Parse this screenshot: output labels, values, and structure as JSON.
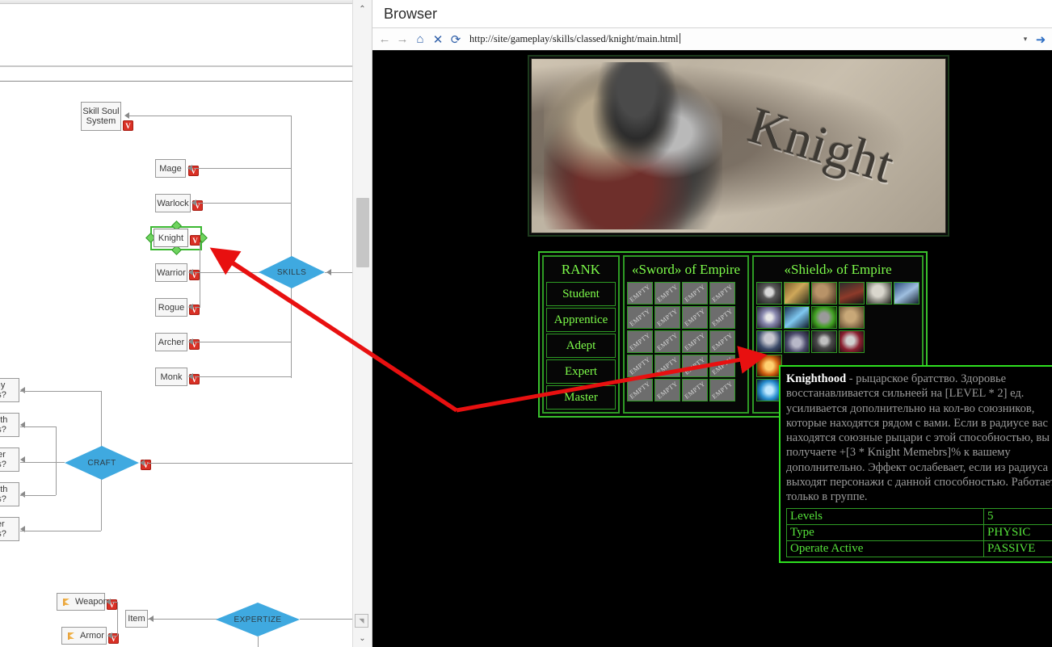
{
  "diagram": {
    "nodes": [
      {
        "id": "skill-soul-system",
        "label": "Skill Soul\nSystem"
      },
      {
        "id": "mage",
        "label": "Mage"
      },
      {
        "id": "warlock",
        "label": "Warlock"
      },
      {
        "id": "knight",
        "label": "Knight"
      },
      {
        "id": "warrior",
        "label": "Warrior"
      },
      {
        "id": "rogue",
        "label": "Rogue"
      },
      {
        "id": "archer",
        "label": "Archer"
      },
      {
        "id": "monk",
        "label": "Monk"
      },
      {
        "id": "item",
        "label": "Item"
      },
      {
        "id": "weapon",
        "label": "Weapon"
      },
      {
        "id": "armor",
        "label": "Armor"
      }
    ],
    "clipped_nodes": [
      {
        "id": "alchemy-recipes",
        "label": "my\nes?"
      },
      {
        "id": "blacksmith-recipes",
        "label": "mith\nes?"
      },
      {
        "id": "leather-recipes",
        "label": "her\nes?"
      },
      {
        "id": "goldsmith-recipes",
        "label": "mith\nes?"
      },
      {
        "id": "tailorer-recipes",
        "label": "rer\nes?"
      }
    ],
    "diamonds": [
      {
        "id": "skills",
        "label": "SKILLS"
      },
      {
        "id": "craft",
        "label": "CRAFT"
      },
      {
        "id": "expertize",
        "label": "EXPERTIZE"
      }
    ],
    "selected_node": "knight",
    "badge_glyph": "V",
    "accent_blue": "#3fa9e0",
    "selection_green": "#3cb832",
    "badge_red": "#d93025",
    "scrollbar": {
      "up": "⌃",
      "down": "⌄",
      "resize": "◥"
    }
  },
  "browser": {
    "window_title": "Browser",
    "toolbar": {
      "back": "←",
      "forward": "→",
      "home": "⌂",
      "stop": "✕",
      "reload": "⟳",
      "dropdown": "▾",
      "go": "➜"
    },
    "url": "http://site/gameplay/skills/classed/knight/main.html"
  },
  "page": {
    "banner": {
      "title": "Knight",
      "art": "knight-armor-illustration"
    },
    "table": {
      "rank_header": "RANK",
      "ranks": [
        "Student",
        "Apprentice",
        "Adept",
        "Expert",
        "Master"
      ],
      "columns": [
        {
          "header": "«Sword» of Empire",
          "type": "empty-slots",
          "empty_label": "EMPTY",
          "rows": [
            [
              "EMPTY",
              "EMPTY",
              "EMPTY",
              "EMPTY"
            ],
            [
              "EMPTY",
              "EMPTY",
              "EMPTY",
              "EMPTY"
            ],
            [
              "EMPTY",
              "EMPTY",
              "EMPTY",
              "EMPTY"
            ],
            [
              "EMPTY",
              "EMPTY",
              "EMPTY",
              "EMPTY"
            ],
            [
              "EMPTY",
              "EMPTY",
              "EMPTY",
              "EMPTY"
            ]
          ]
        },
        {
          "header": "«Shield» of Empire",
          "type": "icon-slots",
          "rows": [
            [
              "shield-crest-icon",
              "shield-wood-gold-icon",
              "shield-round-wood-icon",
              "shield-kite-red-icon",
              "shield-stone-icon",
              "shield-blue-banner-icon"
            ],
            [
              "shield-sunburst-icon",
              "shield-ice-icon",
              "shield-green-vine-icon",
              "shield-leather-icon"
            ],
            [
              "knight-standing-icon",
              "knight-handshake-icon",
              "shield-dark-crest-icon",
              "knight-sparks-icon"
            ],
            [
              "shield-flame-sun-icon"
            ],
            [
              "shield-blue-frost-icon"
            ]
          ]
        }
      ]
    },
    "tooltip": {
      "title": "Knighthood",
      "body": " - рыцарское братство. Здоровье восстанавливается сильнеей на [LEVEL * 2] ед. усиливается дополнительно на кол-во союзников, которые находятся рядом с вами. Если в радиусе вас находятся союзные рыцари с этой способностью, вы получаете +[3 * Knight Memebrs]% к вашему дополнительно. Эффект ослабевает, если из радиуса выходят персонажи с данной способностью. Работает только в группе.",
      "stats": [
        {
          "label": "Levels",
          "value": "5"
        },
        {
          "label": "Type",
          "value": "PHYSIC"
        },
        {
          "label": "Operate Active",
          "value": "PASSIVE"
        }
      ]
    }
  },
  "annotation": {
    "color": "#e81010",
    "shape": "two-segment-arrow-knight-to-shield-icon"
  }
}
